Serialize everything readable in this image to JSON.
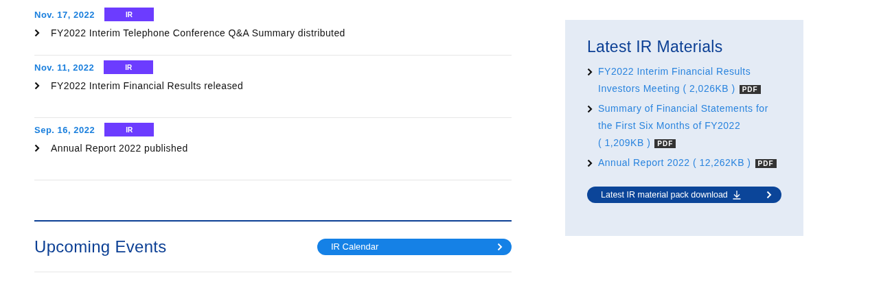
{
  "news": [
    {
      "date": "Nov. 17, 2022",
      "tag": "IR",
      "title": "FY2022 Interim Telephone Conference Q&A Summary distributed"
    },
    {
      "date": "Nov. 11, 2022",
      "tag": "IR",
      "title": "FY2022 Interim Financial Results released"
    },
    {
      "date": "Sep. 16, 2022",
      "tag": "IR",
      "title": "Annual Report 2022 published"
    }
  ],
  "upcoming_events": {
    "title": "Upcoming Events",
    "calendar_button": "IR Calendar"
  },
  "latest_materials": {
    "title": "Latest IR Materials",
    "items": [
      {
        "lines": [
          "FY2022 Interim Financial Results",
          "Investors Meeting ( 2,026KB )"
        ],
        "badge": "PDF"
      },
      {
        "lines": [
          "Summary of Financial Statements for",
          "the First Six Months of FY2022",
          "( 1,209KB )"
        ],
        "badge": "PDF"
      },
      {
        "lines": [
          "Annual Report 2022 ( 12,262KB )"
        ],
        "badge": "PDF"
      }
    ],
    "download_button": "Latest IR material pack download"
  }
}
